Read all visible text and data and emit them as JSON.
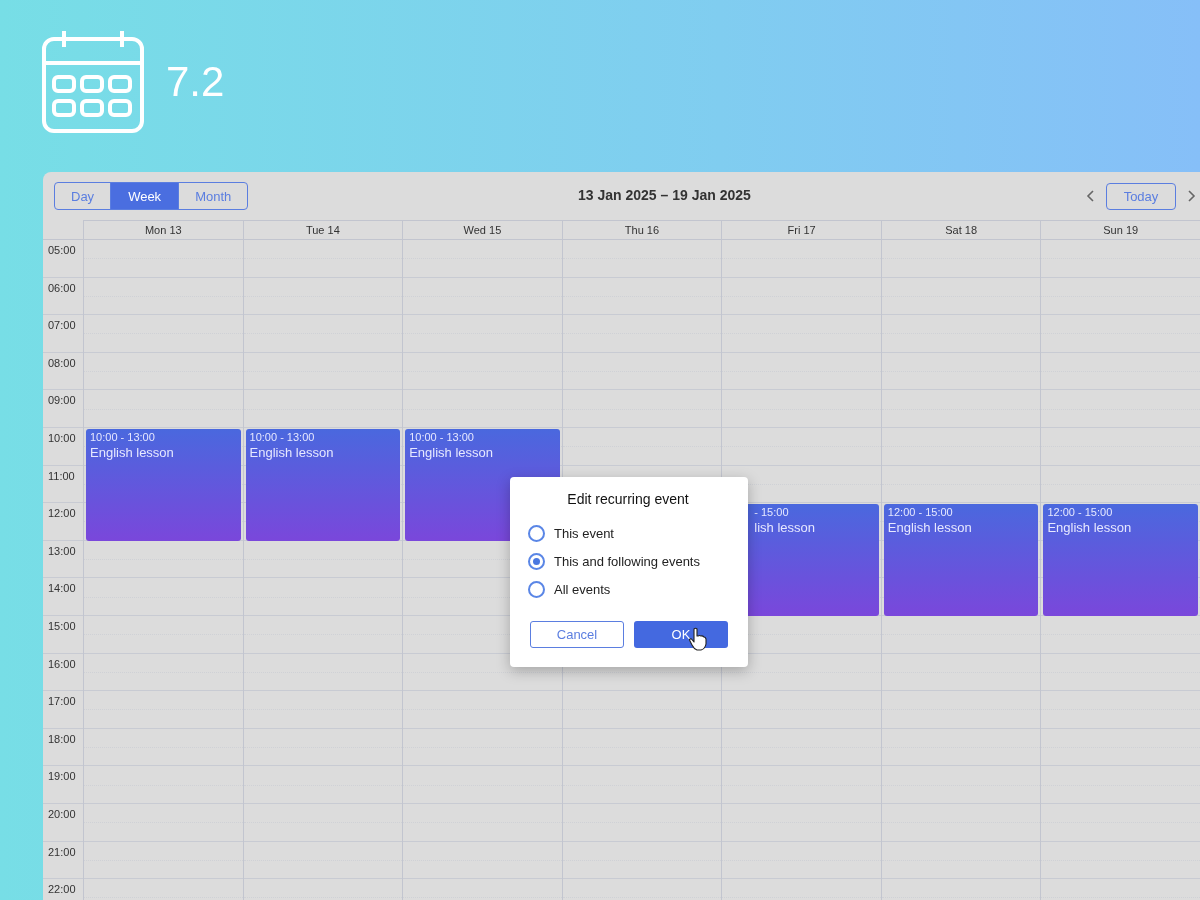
{
  "version": "7.2",
  "toolbar": {
    "views": [
      {
        "label": "Day",
        "selected": false
      },
      {
        "label": "Week",
        "selected": true
      },
      {
        "label": "Month",
        "selected": false
      }
    ],
    "range": "13 Jan 2025 – 19 Jan 2025",
    "today": "Today"
  },
  "hours": [
    "05:00",
    "06:00",
    "07:00",
    "08:00",
    "09:00",
    "10:00",
    "11:00",
    "12:00",
    "13:00",
    "14:00",
    "15:00",
    "16:00",
    "17:00",
    "18:00",
    "19:00",
    "20:00",
    "21:00",
    "22:00"
  ],
  "days": [
    {
      "label": "Mon 13",
      "events": [
        {
          "kind": "full",
          "time": "10:00 - 13:00",
          "title": "English lesson"
        }
      ]
    },
    {
      "label": "Tue 14",
      "events": [
        {
          "kind": "full",
          "time": "10:00 - 13:00",
          "title": "English lesson"
        }
      ]
    },
    {
      "label": "Wed 15",
      "events": [
        {
          "kind": "full",
          "time": "10:00 - 13:00",
          "title": "English lesson"
        }
      ]
    },
    {
      "label": "Thu 16"
    },
    {
      "label": "Fri 17",
      "events": [
        {
          "kind": "covered",
          "time": "- 15:00",
          "title": "lish lesson"
        }
      ]
    },
    {
      "label": "Sat 18",
      "events": [
        {
          "kind": "full",
          "time": "12:00 - 15:00",
          "title": "English lesson"
        }
      ]
    },
    {
      "label": "Sun 19",
      "events": [
        {
          "kind": "full",
          "time": "12:00 - 15:00",
          "title": "English lesson"
        }
      ]
    }
  ],
  "dialog": {
    "title": "Edit recurring event",
    "options": [
      {
        "label": "This event",
        "selected": false
      },
      {
        "label": "This and following events",
        "selected": true
      },
      {
        "label": "All events",
        "selected": false
      }
    ],
    "cancel": "Cancel",
    "ok": "OK"
  }
}
